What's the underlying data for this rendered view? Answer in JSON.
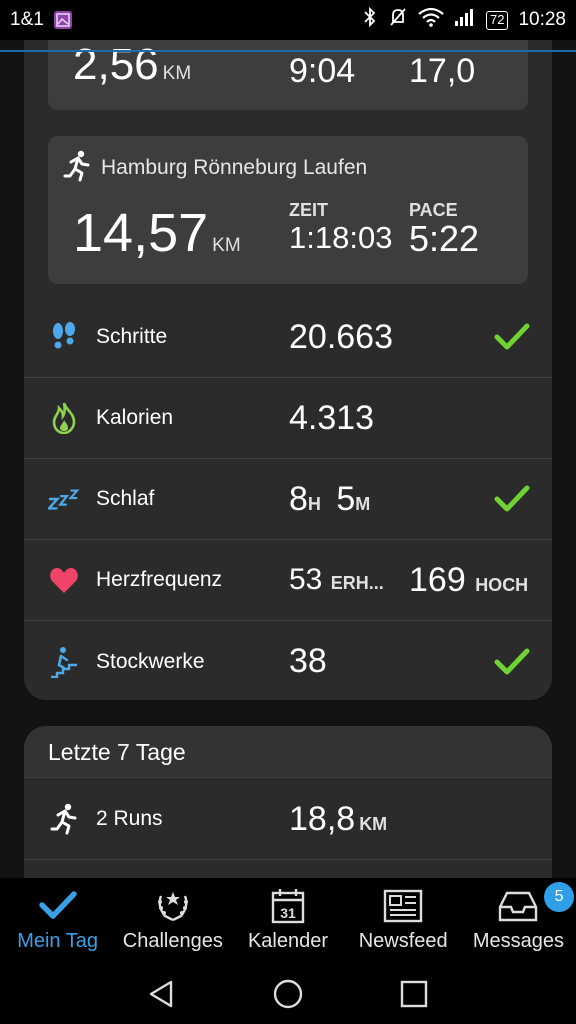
{
  "status_bar": {
    "carrier": "1&1",
    "battery": "72",
    "time": "10:28"
  },
  "prev_activity": {
    "distance": "2,56",
    "distance_unit": "KM",
    "time": "9:04",
    "pace": "17,0"
  },
  "activity": {
    "title": "Hamburg Rönneburg Laufen",
    "distance": "14,57",
    "distance_unit": "KM",
    "time_label": "ZEIT",
    "time": "1:18:03",
    "pace_label": "PACE",
    "pace": "5:22"
  },
  "stats": {
    "steps": {
      "label": "Schritte",
      "value": "20.663"
    },
    "calories": {
      "label": "Kalorien",
      "value": "4.313"
    },
    "sleep": {
      "label": "Schlaf",
      "hours": "8",
      "hours_unit": "H",
      "minutes": "5",
      "minutes_unit": "M"
    },
    "heart": {
      "label": "Herzfrequenz",
      "rest": "53",
      "rest_unit": "ERH...",
      "high": "169",
      "high_unit": "HOCH"
    },
    "floors": {
      "label": "Stockwerke",
      "value": "38"
    }
  },
  "last7": {
    "title": "Letzte 7 Tage",
    "runs_label": "2 Runs",
    "runs_distance": "18,8",
    "runs_unit": "KM"
  },
  "nav": {
    "items": [
      {
        "label": "Mein Tag"
      },
      {
        "label": "Challenges"
      },
      {
        "label": "Kalender"
      },
      {
        "label": "Newsfeed"
      },
      {
        "label": "Messages"
      }
    ],
    "calendar_day": "31",
    "messages_badge": "5"
  },
  "colors": {
    "accent": "#3aa0e6",
    "check": "#6fd334",
    "heart": "#f0436a",
    "steps": "#4ea8ea",
    "calories": "#8fd14f"
  }
}
